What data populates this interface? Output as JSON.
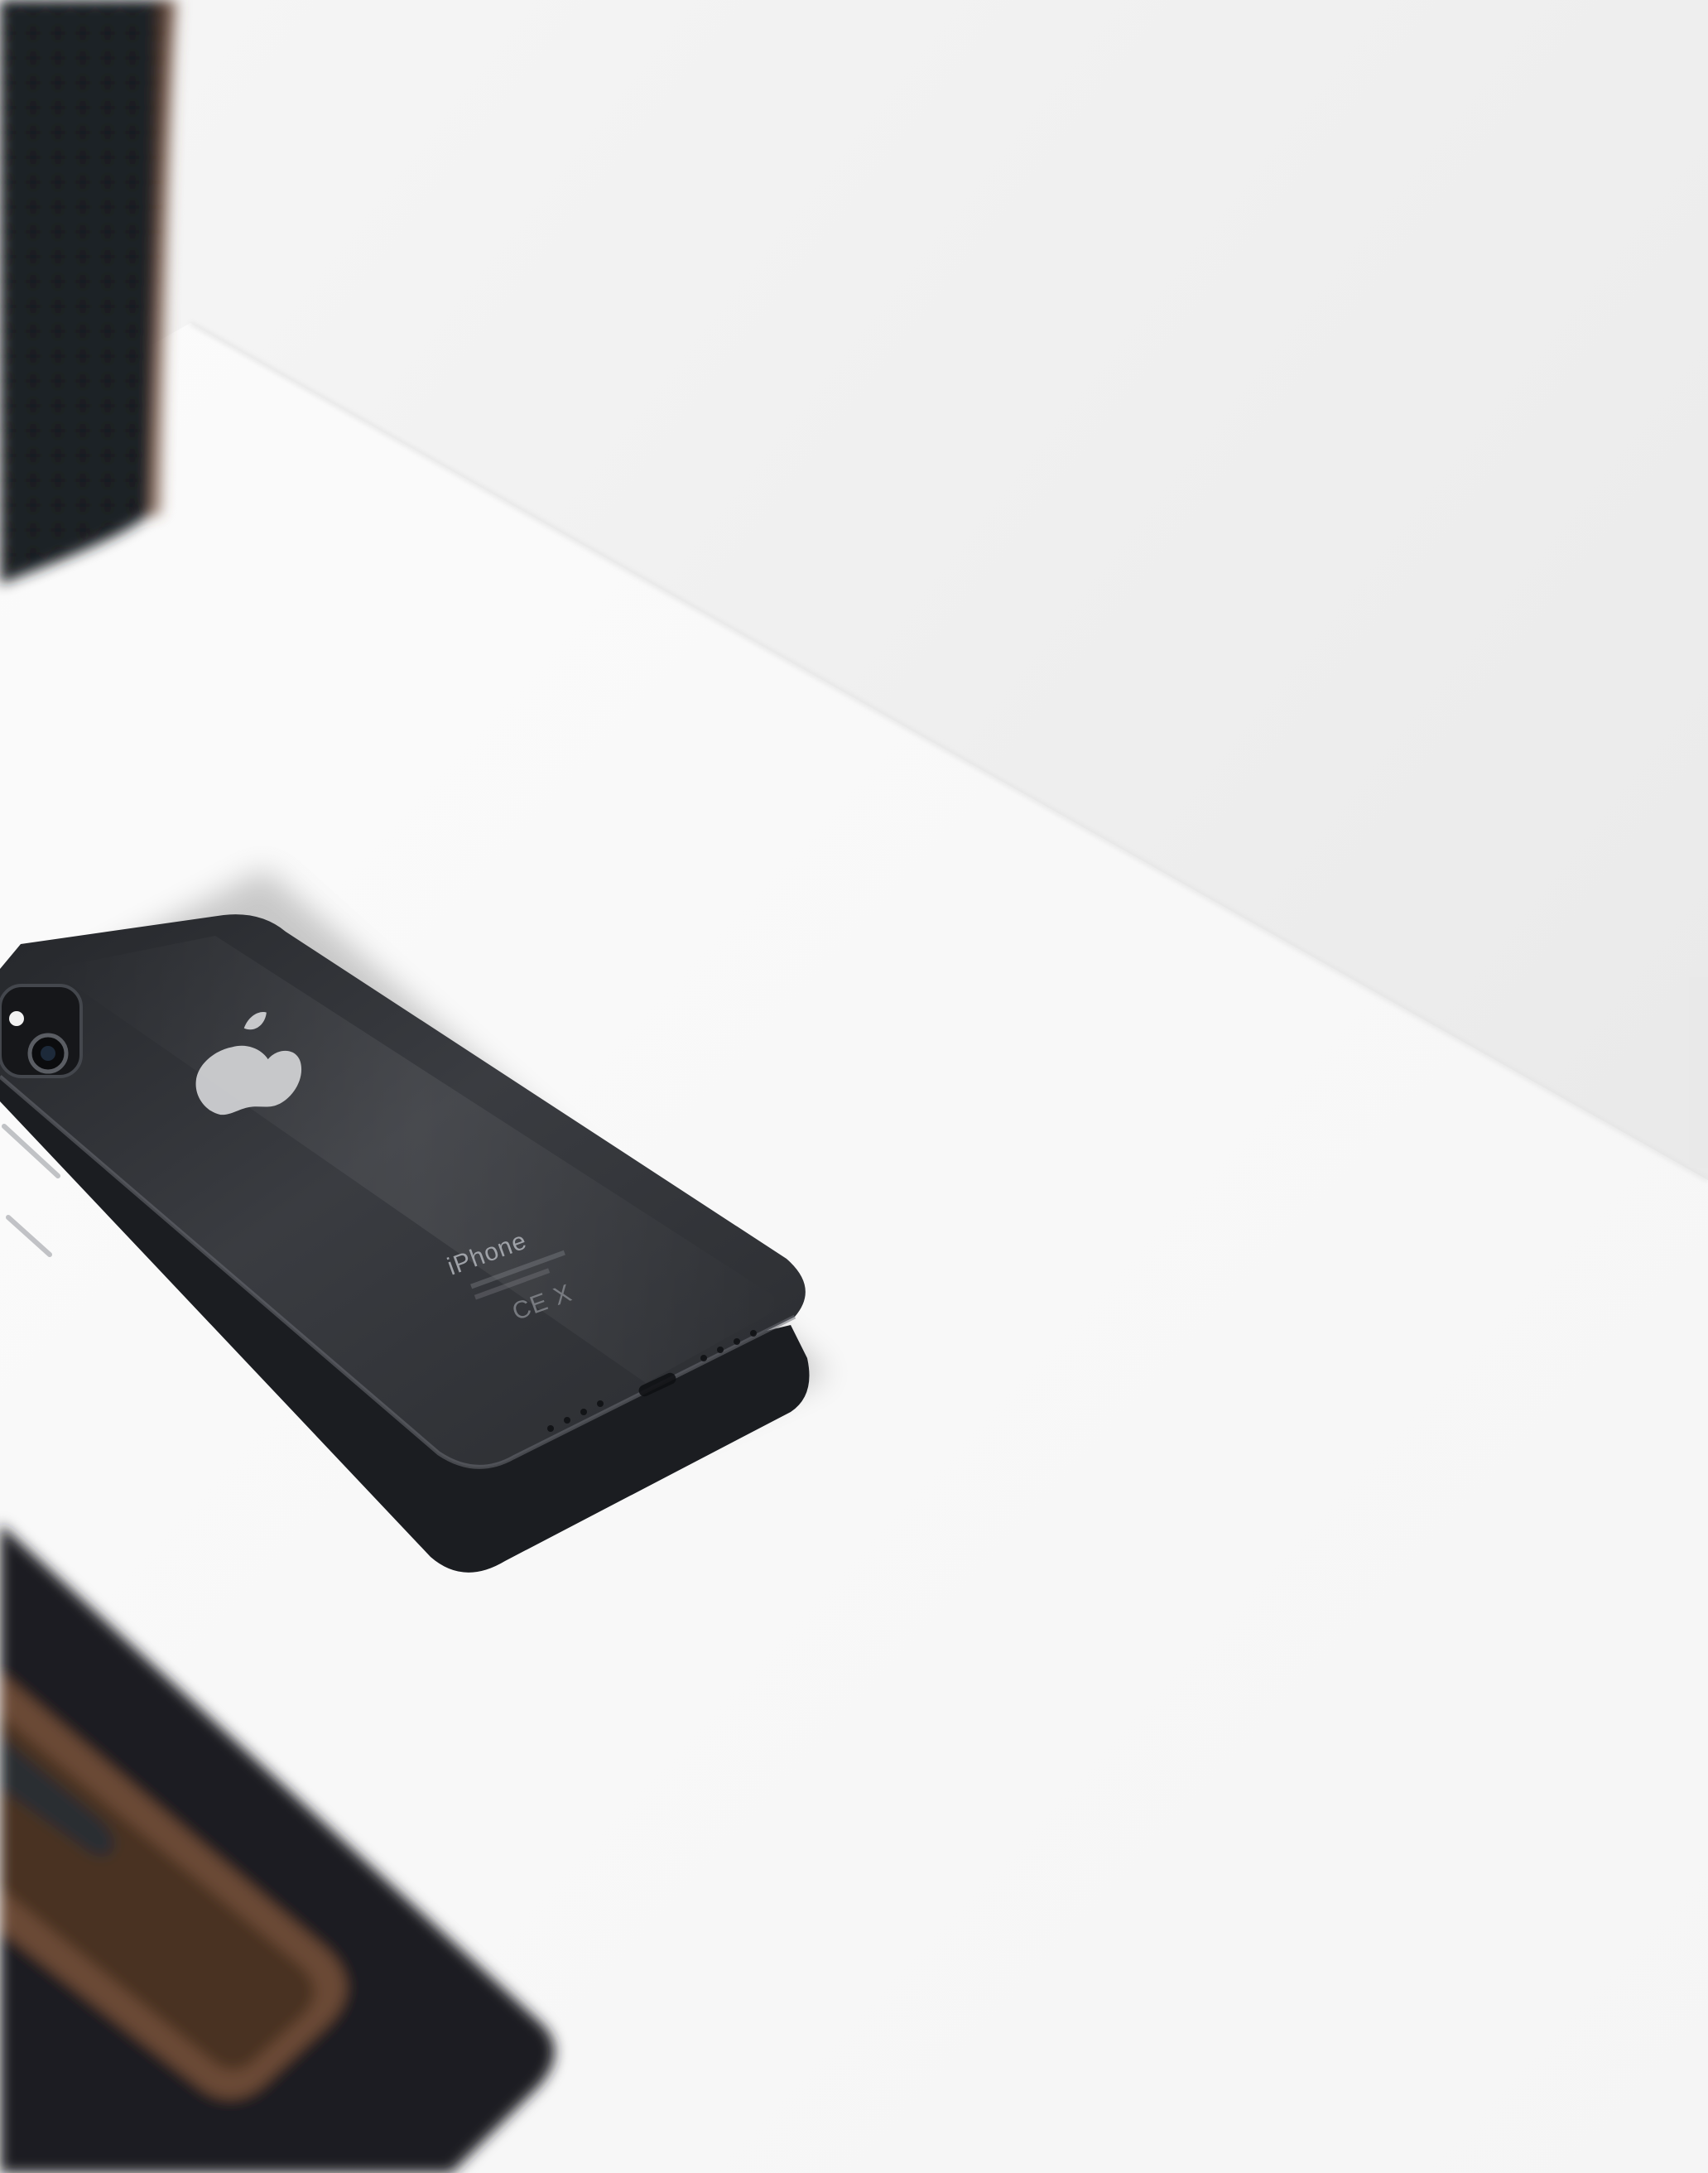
{
  "scene": {
    "subject": "phone-back",
    "phone": {
      "brand_text": "iPhone",
      "regulatory_marks": "CE  X",
      "color": "#2a2c30"
    },
    "colors": {
      "wall": "#eeeeee",
      "desk": "#f7f7f7",
      "speaker": "#1f2125",
      "tray_leather": "#1b1c20",
      "tray_wood": "#6b4a35"
    },
    "icons": [
      "apple-logo-icon",
      "camera-lens-icon"
    ]
  }
}
